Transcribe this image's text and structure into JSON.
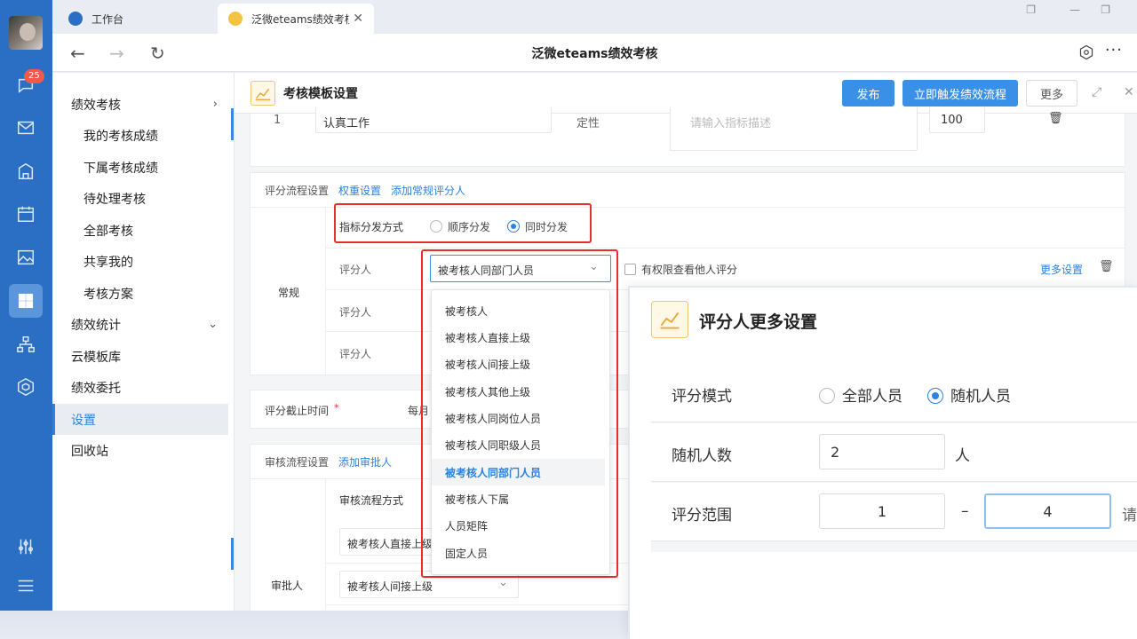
{
  "browser": {
    "tabs": [
      {
        "label": "工作台"
      },
      {
        "label": "泛微eteams绩效考核"
      }
    ],
    "page_title": "泛微eteams绩效考核",
    "more_label": "···"
  },
  "rail": {
    "badge": "25",
    "icons": [
      "message-icon",
      "mail-icon",
      "building-icon",
      "calendar-icon",
      "image-icon",
      "apps-icon",
      "org-chart-icon",
      "cube-icon",
      "sliders-icon",
      "menu-icon"
    ]
  },
  "sidebar": {
    "items": [
      {
        "label": "绩效考核",
        "level": 1,
        "chev": "›"
      },
      {
        "label": "我的考核成绩",
        "level": 2
      },
      {
        "label": "下属考核成绩",
        "level": 2
      },
      {
        "label": "待处理考核",
        "level": 2
      },
      {
        "label": "全部考核",
        "level": 2
      },
      {
        "label": "共享我的",
        "level": 2
      },
      {
        "label": "考核方案",
        "level": 2
      },
      {
        "label": "绩效统计",
        "level": 1,
        "chev": "⌄"
      },
      {
        "label": "云模板库",
        "level": 1
      },
      {
        "label": "绩效委托",
        "level": 1
      },
      {
        "label": "设置",
        "level": 1,
        "active": true
      },
      {
        "label": "回收站",
        "level": 1
      }
    ]
  },
  "header": {
    "title": "考核模板设置",
    "publish": "发布",
    "trigger": "立即触发绩效流程",
    "more": "更多"
  },
  "indicator_row": {
    "index": "1",
    "name": "认真工作",
    "type": "定性",
    "desc_placeholder": "请输入指标描述",
    "weight": "100"
  },
  "scoring": {
    "section": "评分流程设置",
    "weight_link": "权重设置",
    "add_link": "添加常规评分人",
    "dist_label": "指标分发方式",
    "dist_opt1": "顺序分发",
    "dist_opt2": "同时分发",
    "group": "常规",
    "rater_label": "评分人",
    "rater_value": "被考核人同部门人员",
    "limit_check": "有权限查看他人评分",
    "more_settings": "更多设置"
  },
  "deadline": {
    "label": "评分截止时间",
    "required": "*",
    "value": "每月"
  },
  "approval": {
    "section": "审核流程设置",
    "add_link": "添加审批人",
    "method_label": "审核流程方式",
    "approver_label": "审批人",
    "approver1": "被考核人直接上级",
    "approver2": "被考核人间接上级"
  },
  "dropdown": {
    "options": [
      "被考核人",
      "被考核人直接上级",
      "被考核人间接上级",
      "被考核人其他上级",
      "被考核人同岗位人员",
      "被考核人同职级人员",
      "被考核人同部门人员",
      "被考核人下属",
      "人员矩阵",
      "固定人员"
    ],
    "selected_index": 6
  },
  "modal": {
    "title": "评分人更多设置",
    "mode_label": "评分模式",
    "mode_opt1": "全部人员",
    "mode_opt2": "随机人员",
    "count_label": "随机人数",
    "count_value": "2",
    "count_unit": "人",
    "range_label": "评分范围",
    "range_min": "1",
    "range_sep": "–",
    "range_max": "4",
    "range_hint": "请"
  },
  "colors": {
    "rail": "#2b6fc4",
    "accent": "#2b82e0",
    "primary_button": "#3a90e6",
    "highlight": "#e5302c"
  }
}
